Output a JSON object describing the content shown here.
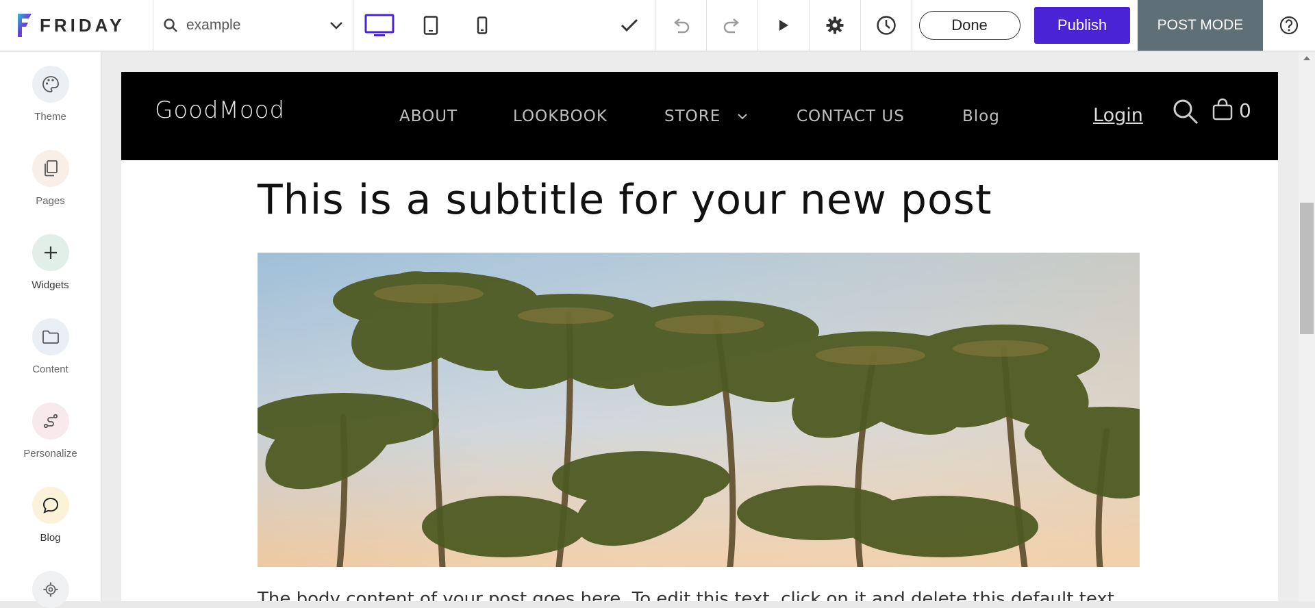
{
  "app": {
    "logo_text": "FRIDAY",
    "page_selector": {
      "value": "example"
    },
    "buttons": {
      "done": "Done",
      "publish": "Publish",
      "post_mode": "POST MODE"
    },
    "colors": {
      "accent": "#4a23d4",
      "post_mode_bg": "#5f6f78",
      "device_active": "#4a23d4"
    }
  },
  "sidebar": {
    "items": [
      {
        "label": "Theme",
        "icon": "palette-icon"
      },
      {
        "label": "Pages",
        "icon": "pages-icon"
      },
      {
        "label": "Widgets",
        "icon": "plus-icon"
      },
      {
        "label": "Content",
        "icon": "folder-icon"
      },
      {
        "label": "Personalize",
        "icon": "personalize-icon"
      },
      {
        "label": "Blog",
        "icon": "chat-bubble-icon"
      },
      {
        "label": "",
        "icon": "gear-icon"
      }
    ]
  },
  "site": {
    "brand": "GoodMood",
    "nav": [
      "ABOUT",
      "LOOKBOOK",
      "STORE",
      "CONTACT US",
      "Blog"
    ],
    "login": "Login",
    "cart_count": "0",
    "post": {
      "subtitle": "This is a subtitle for your new post",
      "body": "The body content of your post goes here. To edit this text, click on it and delete this default text"
    }
  }
}
